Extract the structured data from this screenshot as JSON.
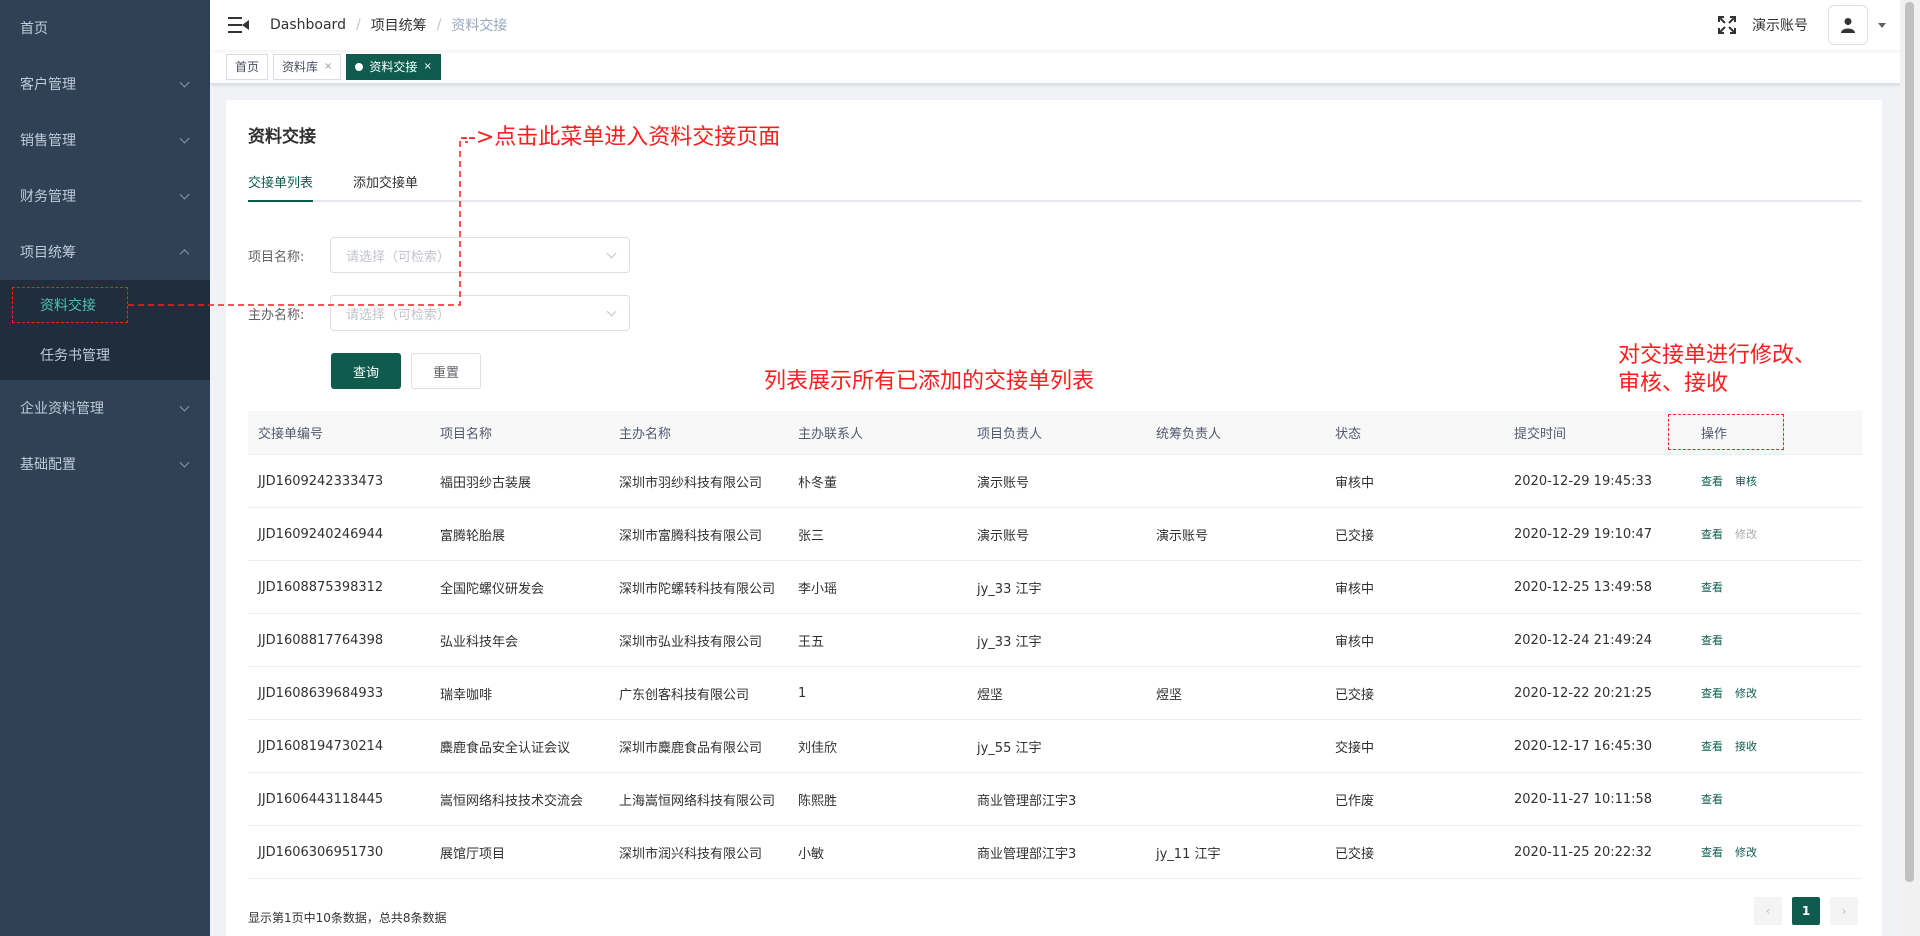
{
  "sidebar": {
    "items": [
      {
        "label": "首页"
      },
      {
        "label": "客户管理"
      },
      {
        "label": "销售管理"
      },
      {
        "label": "财务管理"
      },
      {
        "label": "项目统筹"
      },
      {
        "label": "企业资料管理"
      },
      {
        "label": "基础配置"
      }
    ],
    "submenu": [
      "资料交接",
      "任务书管理"
    ]
  },
  "header": {
    "breadcrumb": [
      "Dashboard",
      "项目统筹",
      "资料交接"
    ],
    "user_name": "演示账号"
  },
  "tags": [
    {
      "label": "首页"
    },
    {
      "label": "资料库"
    },
    {
      "label": "资料交接"
    }
  ],
  "page": {
    "title": "资料交接",
    "tabs": [
      "交接单列表",
      "添加交接单"
    ],
    "form": {
      "project_label": "项目名称:",
      "project_placeholder": "请选择（可检索）",
      "organizer_label": "主办名称:",
      "organizer_placeholder": "请选择（可检索）",
      "query_button": "查询",
      "reset_button": "重置"
    }
  },
  "table": {
    "columns": [
      "交接单编号",
      "项目名称",
      "主办名称",
      "主办联系人",
      "项目负责人",
      "统筹负责人",
      "状态",
      "提交时间",
      "操作"
    ],
    "rows": [
      {
        "id": "JJD1609242333473",
        "project": "福田羽纱古装展",
        "organizer": "深圳市羽纱科技有限公司",
        "contact": "朴冬董",
        "pm": "演示账号",
        "coordinator": "",
        "status": "审核中",
        "time": "2020-12-29 19:45:33",
        "ops": [
          {
            "label": "查看",
            "enabled": true
          },
          {
            "label": "审核",
            "enabled": true
          }
        ]
      },
      {
        "id": "JJD1609240246944",
        "project": "富腾轮胎展",
        "organizer": "深圳市富腾科技有限公司",
        "contact": "张三",
        "pm": "演示账号",
        "coordinator": "演示账号",
        "status": "已交接",
        "time": "2020-12-29 19:10:47",
        "ops": [
          {
            "label": "查看",
            "enabled": true
          },
          {
            "label": "修改",
            "enabled": false
          }
        ]
      },
      {
        "id": "JJD1608875398312",
        "project": "全国陀螺仪研发会",
        "organizer": "深圳市陀螺转科技有限公司",
        "contact": "李小瑶",
        "pm": "jy_33 江宇",
        "coordinator": "",
        "status": "审核中",
        "time": "2020-12-25 13:49:58",
        "ops": [
          {
            "label": "查看",
            "enabled": true
          }
        ]
      },
      {
        "id": "JJD1608817764398",
        "project": "弘业科技年会",
        "organizer": "深圳市弘业科技有限公司",
        "contact": "王五",
        "pm": "jy_33 江宇",
        "coordinator": "",
        "status": "审核中",
        "time": "2020-12-24 21:49:24",
        "ops": [
          {
            "label": "查看",
            "enabled": true
          }
        ]
      },
      {
        "id": "JJD1608639684933",
        "project": "瑞幸咖啡",
        "organizer": "广东创客科技有限公司",
        "contact": "1",
        "pm": "煜坚",
        "coordinator": "煜坚",
        "status": "已交接",
        "time": "2020-12-22 20:21:25",
        "ops": [
          {
            "label": "查看",
            "enabled": true
          },
          {
            "label": "修改",
            "enabled": true
          }
        ]
      },
      {
        "id": "JJD1608194730214",
        "project": "麋鹿食品安全认证会议",
        "organizer": "深圳市麋鹿食品有限公司",
        "contact": "刘佳欣",
        "pm": "jy_55 江宇",
        "coordinator": "",
        "status": "交接中",
        "time": "2020-12-17 16:45:30",
        "ops": [
          {
            "label": "查看",
            "enabled": true
          },
          {
            "label": "接收",
            "enabled": true
          }
        ]
      },
      {
        "id": "JJD1606443118445",
        "project": "嵩恒网络科技技术交流会",
        "organizer": "上海嵩恒网络科技有限公司",
        "contact": "陈熙胜",
        "pm": "商业管理部江宇3",
        "coordinator": "",
        "status": "已作废",
        "time": "2020-11-27 10:11:58",
        "ops": [
          {
            "label": "查看",
            "enabled": true
          }
        ]
      },
      {
        "id": "JJD1606306951730",
        "project": "展馆厅项目",
        "organizer": "深圳市润兴科技有限公司",
        "contact": "小敏",
        "pm": "商业管理部江宇3",
        "coordinator": "jy_11 江宇",
        "status": "已交接",
        "time": "2020-11-25 20:22:32",
        "ops": [
          {
            "label": "查看",
            "enabled": true
          },
          {
            "label": "修改",
            "enabled": true
          }
        ]
      }
    ]
  },
  "footer": {
    "info": "显示第1页中10条数据，总共8条数据",
    "current_page": "1"
  },
  "annotations": {
    "menu_hint": "-->点击此菜单进入资料交接页面",
    "list_hint": "列表展示所有已添加的交接单列表",
    "ops_hint_line1": "对交接单进行修改、",
    "ops_hint_line2": "审核、接收"
  },
  "colors": {
    "sidebar_bg": "#304156",
    "primary": "#0f5c4e",
    "annotation": "#ff1d1d"
  }
}
